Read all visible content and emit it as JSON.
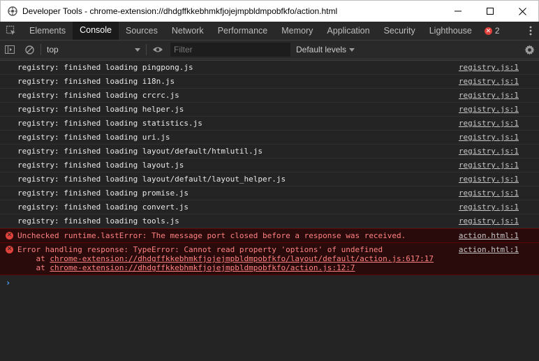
{
  "window": {
    "title": "Developer Tools - chrome-extension://dhdgffkkebhmkfjojejmpbldmpobfkfo/action.html",
    "icon": "devtools-icon"
  },
  "tabs": [
    {
      "label": "Elements"
    },
    {
      "label": "Console",
      "active": true
    },
    {
      "label": "Sources"
    },
    {
      "label": "Network"
    },
    {
      "label": "Performance"
    },
    {
      "label": "Memory"
    },
    {
      "label": "Application"
    },
    {
      "label": "Security"
    },
    {
      "label": "Lighthouse"
    }
  ],
  "error_badge": {
    "count": "2"
  },
  "toolbar": {
    "context": "top",
    "filter_placeholder": "Filter",
    "levels": "Default levels"
  },
  "messages": [
    {
      "text": "registry: finished loading pingpong.js",
      "source": "registry.js:1"
    },
    {
      "text": "registry: finished loading i18n.js",
      "source": "registry.js:1"
    },
    {
      "text": "registry: finished loading crcrc.js",
      "source": "registry.js:1"
    },
    {
      "text": "registry: finished loading helper.js",
      "source": "registry.js:1"
    },
    {
      "text": "registry: finished loading statistics.js",
      "source": "registry.js:1"
    },
    {
      "text": "registry: finished loading uri.js",
      "source": "registry.js:1"
    },
    {
      "text": "registry: finished loading layout/default/htmlutil.js",
      "source": "registry.js:1"
    },
    {
      "text": "registry: finished loading layout.js",
      "source": "registry.js:1"
    },
    {
      "text": "registry: finished loading layout/default/layout_helper.js",
      "source": "registry.js:1"
    },
    {
      "text": "registry: finished loading promise.js",
      "source": "registry.js:1"
    },
    {
      "text": "registry: finished loading convert.js",
      "source": "registry.js:1"
    },
    {
      "text": "registry: finished loading tools.js",
      "source": "registry.js:1"
    }
  ],
  "errors": [
    {
      "text": "Unchecked runtime.lastError: The message port closed before a response was received.",
      "source": "action.html:1"
    },
    {
      "text": "Error handling response: TypeError: Cannot read property 'options' of undefined",
      "source": "action.html:1",
      "stack": [
        {
          "prefix": "    at ",
          "link": "chrome-extension://dhdgffkkebhmkfjojejmpbldmpobfkfo/layout/default/action.js:617:17"
        },
        {
          "prefix": "    at ",
          "link": "chrome-extension://dhdgffkkebhmkfjojejmpbldmpobfkfo/action.js:12:7"
        }
      ]
    }
  ],
  "colors": {
    "error_text": "#ff8080",
    "error_bg": "#2a0b0b",
    "error_icon": "#e0413a",
    "prompt": "#4fa3ff"
  }
}
